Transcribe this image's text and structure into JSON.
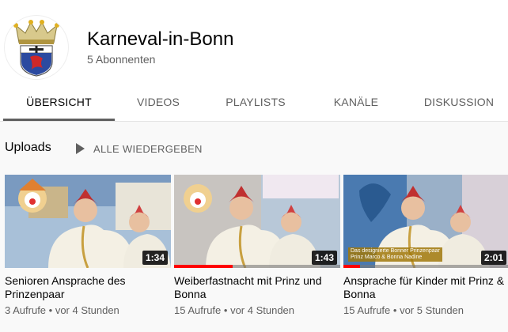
{
  "channel": {
    "name": "Karneval-in-Bonn",
    "subscribers": "5 Abonnenten"
  },
  "tabs": [
    {
      "label": "ÜBERSICHT",
      "active": true
    },
    {
      "label": "VIDEOS"
    },
    {
      "label": "PLAYLISTS"
    },
    {
      "label": "KANÄLE"
    },
    {
      "label": "DISKUSSION"
    }
  ],
  "shelf": {
    "title": "Uploads",
    "play_all": "ALLE WIEDERGEBEN",
    "play_icon": "play-icon"
  },
  "videos": [
    {
      "title": "Senioren Ansprache des Prinzenpaar",
      "duration": "1:34",
      "views": "3 Aufrufe",
      "age": "vor 4 Stunden",
      "watched": 0
    },
    {
      "title": "Weiberfastnacht mit Prinz und Bonna",
      "duration": "1:43",
      "views": "15 Aufrufe",
      "age": "vor 4 Stunden",
      "watched": 0.35
    },
    {
      "title": "Ansprache für Kinder mit Prinz & Bonna",
      "duration": "2:01",
      "views": "15 Aufrufe",
      "age": "vor 5 Stunden",
      "watched": 0.1,
      "caption": [
        "Das designierte Bonner Prinzenpaar",
        "Prinz Marco & Bonna Nadine"
      ]
    }
  ],
  "meta_separator": " • ",
  "colors": {
    "accent_red": "#ff0000",
    "text_primary": "#030303",
    "text_secondary": "#606060",
    "background": "#f9f9f9"
  }
}
